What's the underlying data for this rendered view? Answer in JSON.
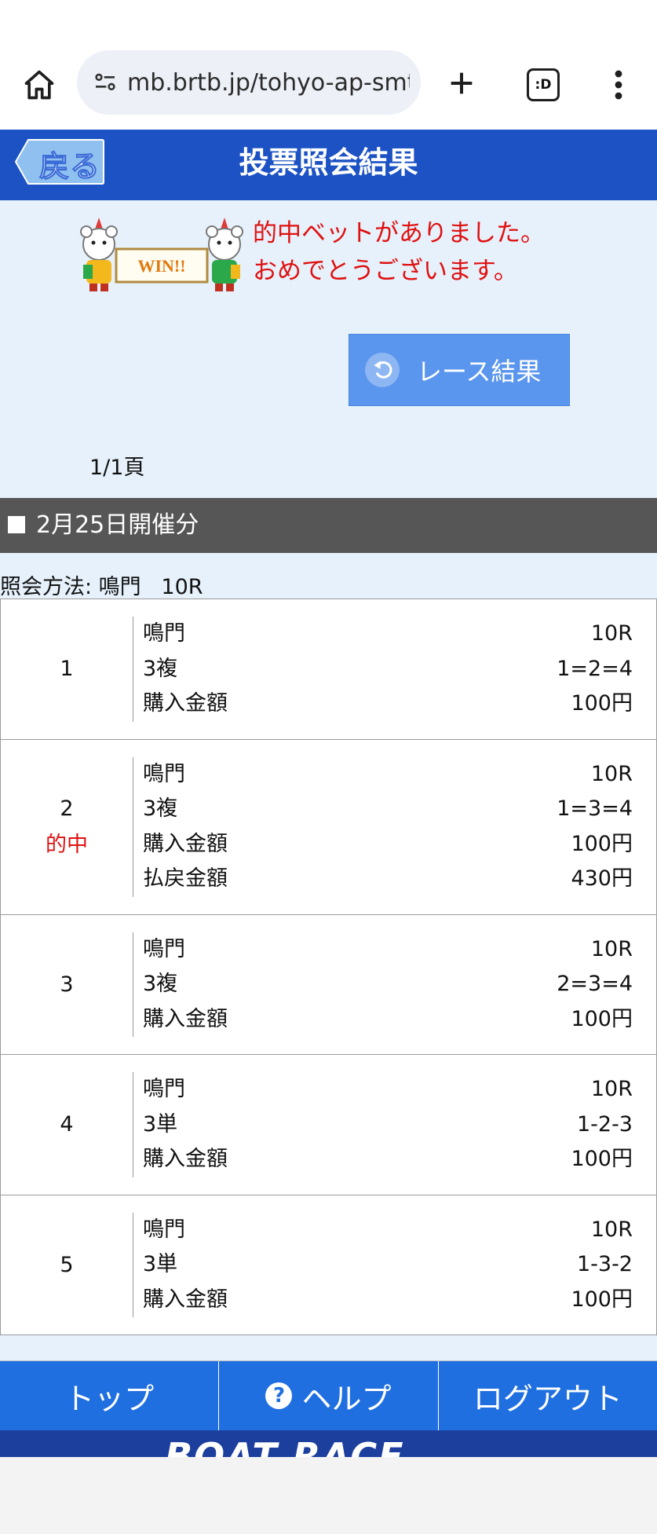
{
  "browser": {
    "url": "mb.brtb.jp/tohyo-ap-smt",
    "tab_count_label": ":D"
  },
  "header": {
    "back_label": "戻る",
    "title": "投票照会結果"
  },
  "win": {
    "banner_text": "WIN!!",
    "message_line1": "的中ベットがありました。",
    "message_line2": "おめでとうございます。"
  },
  "race_result_button": "レース結果",
  "pager": "1/1頁",
  "date_header": "2月25日開催分",
  "query_method": "照会方法: 鳴門   10R",
  "bets": [
    {
      "no": "1",
      "hit": "",
      "rows": [
        {
          "label": "鳴門",
          "value": "10R"
        },
        {
          "label": "3複",
          "value": "1=2=4"
        },
        {
          "label": "購入金額",
          "value": "100円"
        }
      ]
    },
    {
      "no": "2",
      "hit": "的中",
      "rows": [
        {
          "label": "鳴門",
          "value": "10R"
        },
        {
          "label": "3複",
          "value": "1=3=4"
        },
        {
          "label": "購入金額",
          "value": "100円"
        },
        {
          "label": "払戻金額",
          "value": "430円"
        }
      ]
    },
    {
      "no": "3",
      "hit": "",
      "rows": [
        {
          "label": "鳴門",
          "value": "10R"
        },
        {
          "label": "3複",
          "value": "2=3=4"
        },
        {
          "label": "購入金額",
          "value": "100円"
        }
      ]
    },
    {
      "no": "4",
      "hit": "",
      "rows": [
        {
          "label": "鳴門",
          "value": "10R"
        },
        {
          "label": "3単",
          "value": "1-2-3"
        },
        {
          "label": "購入金額",
          "value": "100円"
        }
      ]
    },
    {
      "no": "5",
      "hit": "",
      "rows": [
        {
          "label": "鳴門",
          "value": "10R"
        },
        {
          "label": "3単",
          "value": "1-3-2"
        },
        {
          "label": "購入金額",
          "value": "100円"
        }
      ]
    }
  ],
  "footer": {
    "top": "トップ",
    "help": "ヘルプ",
    "logout": "ログアウト"
  },
  "brand": "BOAT RACE",
  "colors": {
    "header_blue": "#1c52c4",
    "footer_blue": "#1f6fe0",
    "hit_red": "#e01010",
    "page_bg": "#e6f1fb"
  }
}
